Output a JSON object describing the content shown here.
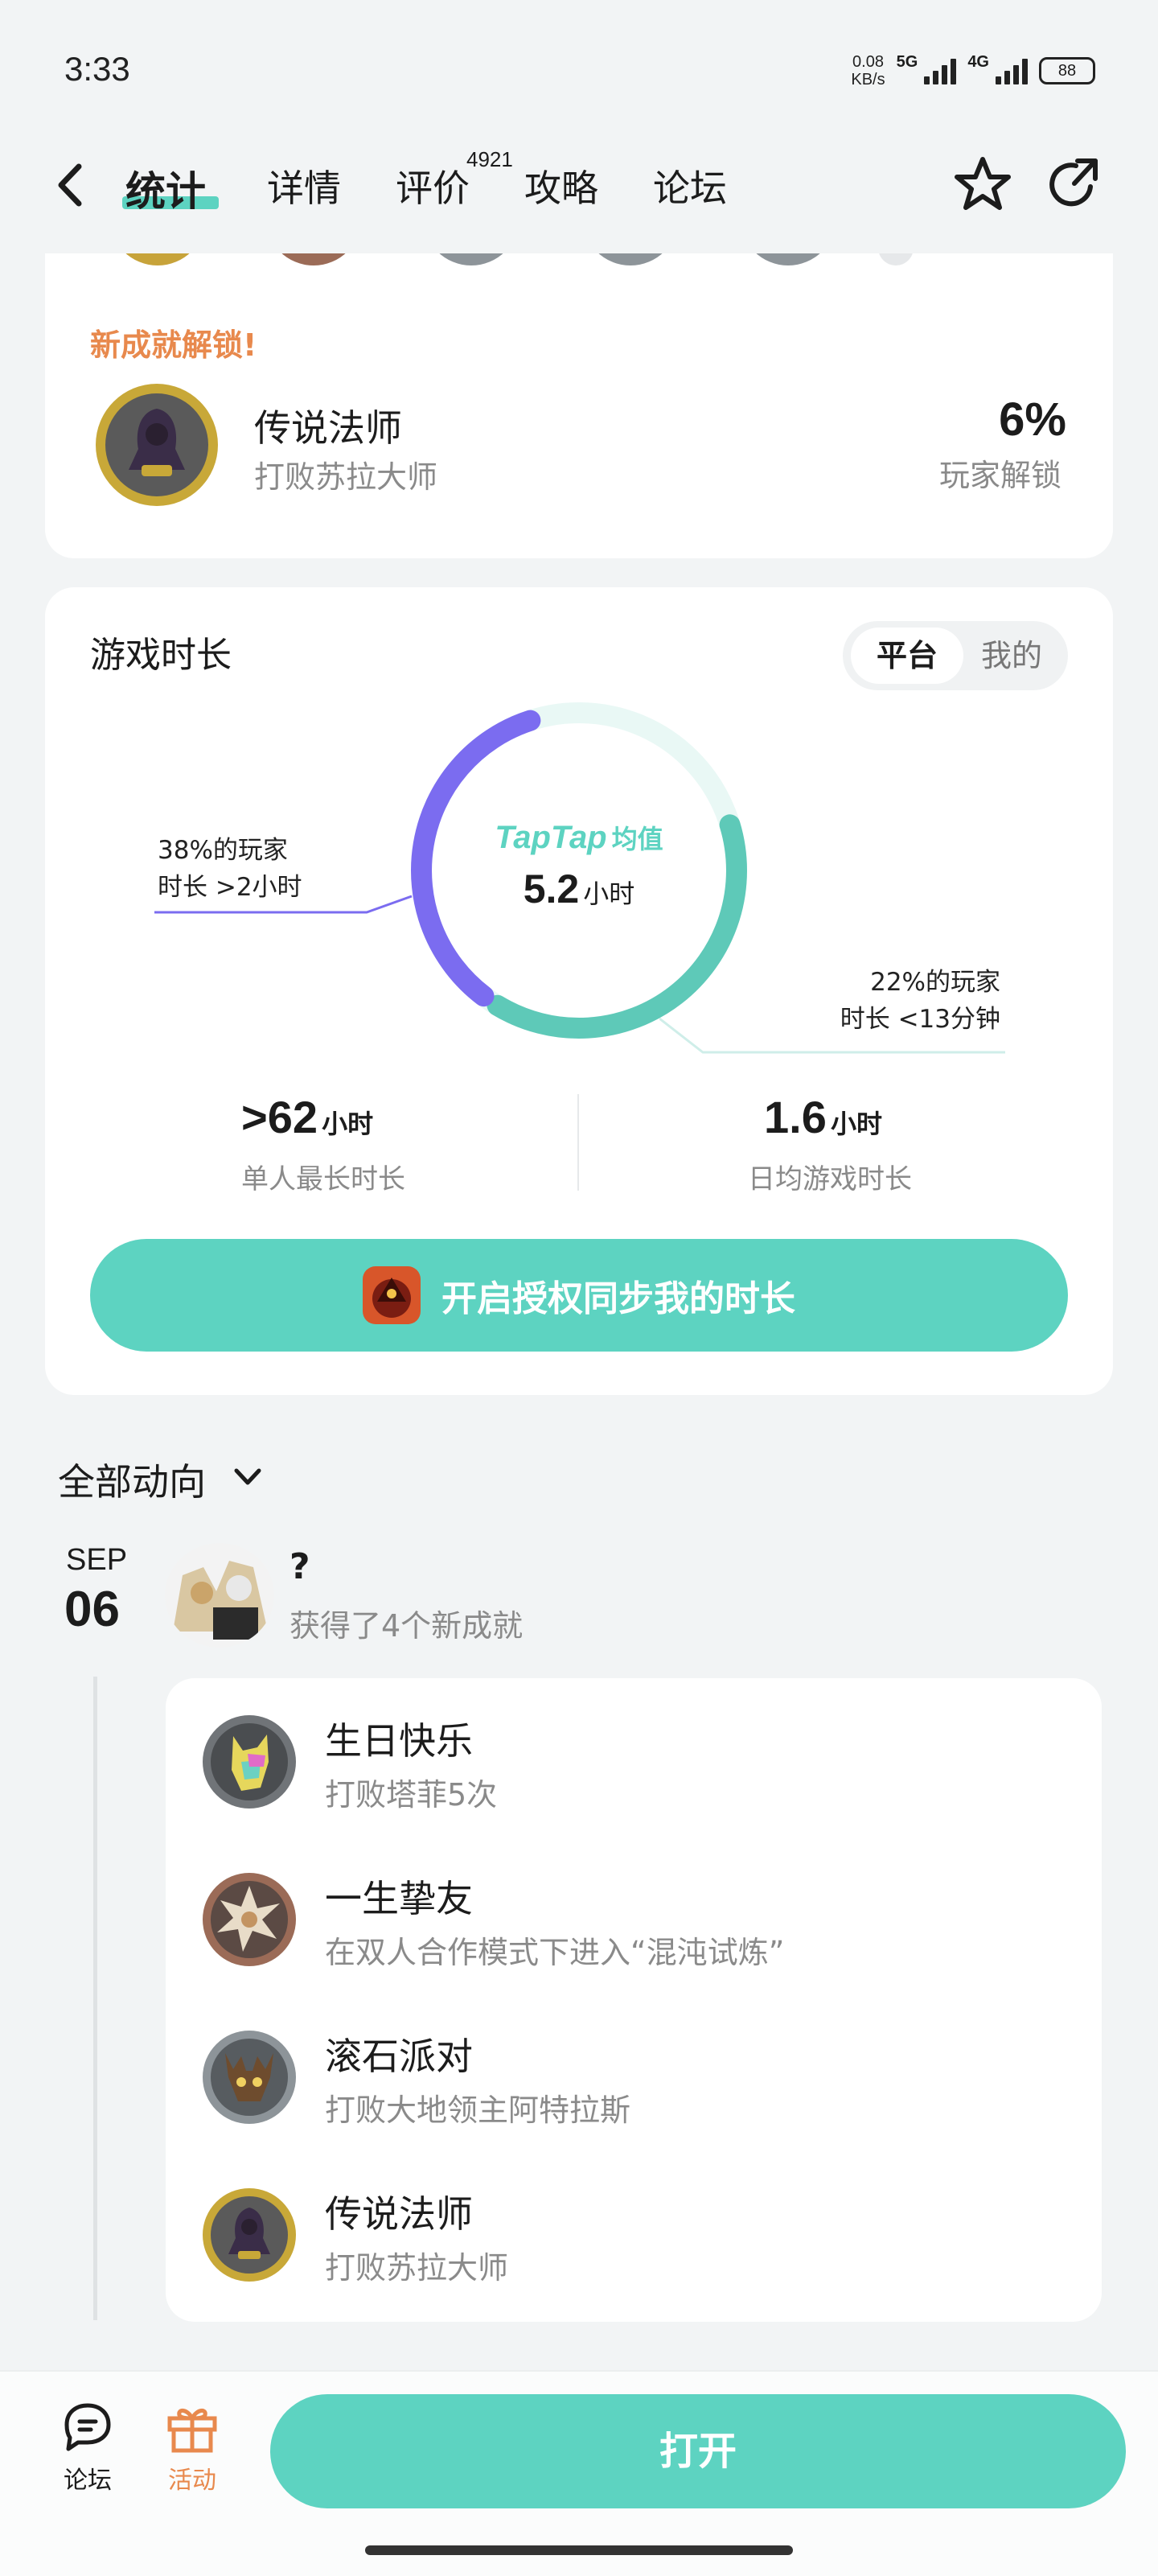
{
  "status_bar": {
    "time": "3:33",
    "net_speed_value": "0.08",
    "net_speed_unit": "KB/s",
    "signal1_label": "5G",
    "signal2_label": "4G",
    "battery": "88"
  },
  "nav": {
    "tabs": [
      {
        "label": "统计",
        "active": true
      },
      {
        "label": "详情",
        "active": false
      },
      {
        "label": "评价",
        "active": false
      },
      {
        "label": "攻略",
        "active": false
      },
      {
        "label": "论坛",
        "active": false
      }
    ],
    "review_count": "4921",
    "accent_color": "#5dd3c1"
  },
  "achievement_unlock": {
    "heading": "新成就解锁!",
    "title": "传说法师",
    "subtitle": "打败苏拉大师",
    "percent": "6%",
    "percent_label": "玩家解锁"
  },
  "playtime": {
    "title": "游戏时长",
    "toggle_options": [
      "平台",
      "我的"
    ],
    "toggle_selected": "平台",
    "brand": "TapTap",
    "brand_suffix": "均值",
    "average_value": "5.2",
    "average_unit": "小时",
    "callout_left_line1": "38%的玩家",
    "callout_left_line2": "时长 >2小时",
    "callout_right_line1": "22%的玩家",
    "callout_right_line2": "时长 <13分钟",
    "max_value": ">62",
    "max_unit": "小时",
    "max_label": "单人最长时长",
    "daily_value": "1.6",
    "daily_unit": "小时",
    "daily_label": "日均游戏时长",
    "sync_button": "开启授权同步我的时长",
    "segments": {
      "over_2h_share": 0.38,
      "under_13m_share": 0.22
    },
    "colors": {
      "long": "#7b6cf0",
      "mid": "#5ec9b8",
      "short": "#e6f7f4"
    }
  },
  "feed": {
    "title": "全部动向",
    "month": "SEP",
    "day": "06",
    "user_name": "?",
    "user_action": "获得了4个新成就",
    "achievements": [
      {
        "title": "生日快乐",
        "subtitle": "打败塔菲5次"
      },
      {
        "title": "一生挚友",
        "subtitle": "在双人合作模式下进入“混沌试炼”"
      },
      {
        "title": "滚石派对",
        "subtitle": "打败大地领主阿特拉斯"
      },
      {
        "title": "传说法师",
        "subtitle": "打败苏拉大师"
      }
    ]
  },
  "bottom_bar": {
    "forum_label": "论坛",
    "activity_label": "活动",
    "open_button": "打开",
    "activity_color": "#e8894d"
  }
}
